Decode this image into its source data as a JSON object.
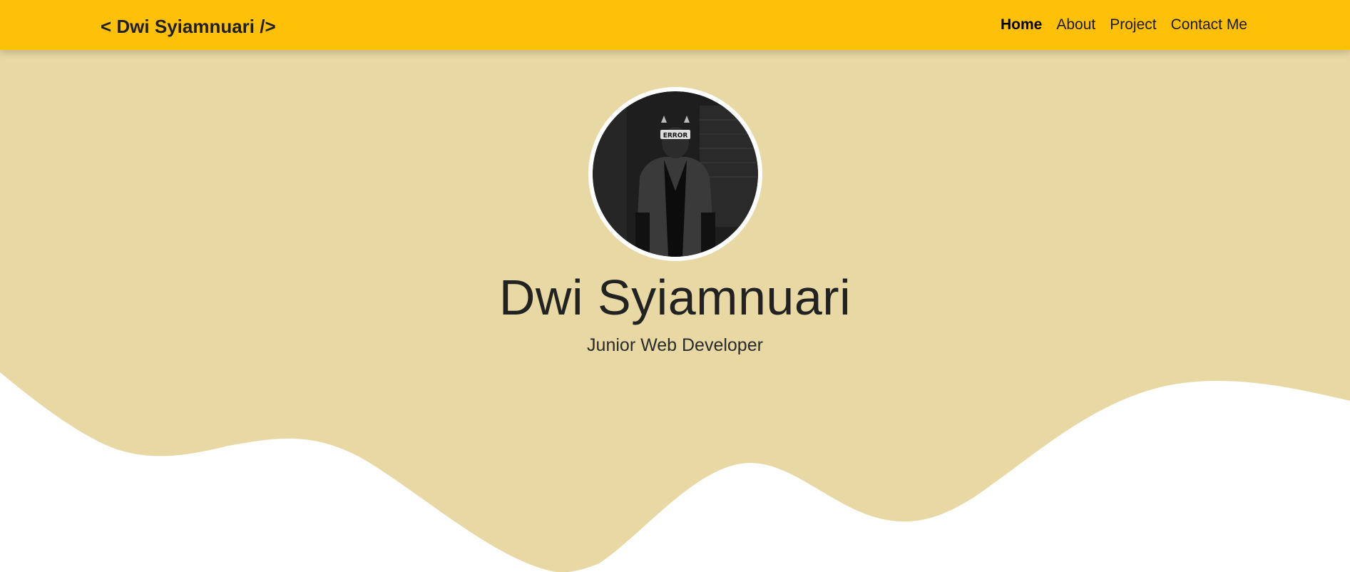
{
  "header": {
    "brand": "< Dwi Syiamnuari />",
    "nav": [
      {
        "label": "Home",
        "active": true
      },
      {
        "label": "About",
        "active": false
      },
      {
        "label": "Project",
        "active": false
      },
      {
        "label": "Contact Me",
        "active": false
      }
    ]
  },
  "hero": {
    "name": "Dwi Syiamnuari",
    "subtitle": "Junior Web Developer",
    "avatar_badge": "ERROR"
  },
  "colors": {
    "navbar": "#ffc107",
    "hero_background": "#e8d9a4",
    "page_background": "#ffffff",
    "text_dark": "#222222"
  }
}
